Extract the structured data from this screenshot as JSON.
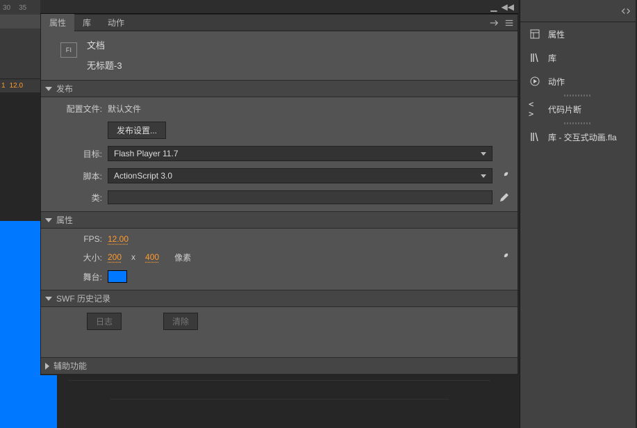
{
  "timeline": {
    "marks": [
      "30",
      "35"
    ],
    "frame": "1",
    "fps_strip": "12.0"
  },
  "panelHeader": {
    "tabs": {
      "properties": "属性",
      "library": "库",
      "actions": "动作"
    }
  },
  "doc": {
    "title": "文档",
    "filename": "无标题-3",
    "icon_text": "Fl"
  },
  "publish": {
    "header": "发布",
    "profile_label": "配置文件:",
    "profile_value": "默认文件",
    "settings_btn": "发布设置...",
    "target_label": "目标:",
    "target_value": "Flash Player 11.7",
    "script_label": "脚本:",
    "script_value": "ActionScript 3.0",
    "class_label": "类:"
  },
  "properties": {
    "header": "属性",
    "fps_label": "FPS:",
    "fps_value": "12.00",
    "size_label": "大小:",
    "size_w": "200",
    "size_x": "x",
    "size_h": "400",
    "size_unit": "像素",
    "stage_label": "舞台:",
    "stage_color": "#0078ff"
  },
  "swf": {
    "header": "SWF 历史记录",
    "log_btn": "日志",
    "clear_btn": "清除"
  },
  "aux": {
    "header": "辅助功能"
  },
  "rightDock": {
    "items": {
      "properties": "属性",
      "library": "库",
      "actions": "动作",
      "snippets": "代码片断",
      "lib_file": "库 - 交互式动画.fla"
    },
    "angles": "< >"
  }
}
